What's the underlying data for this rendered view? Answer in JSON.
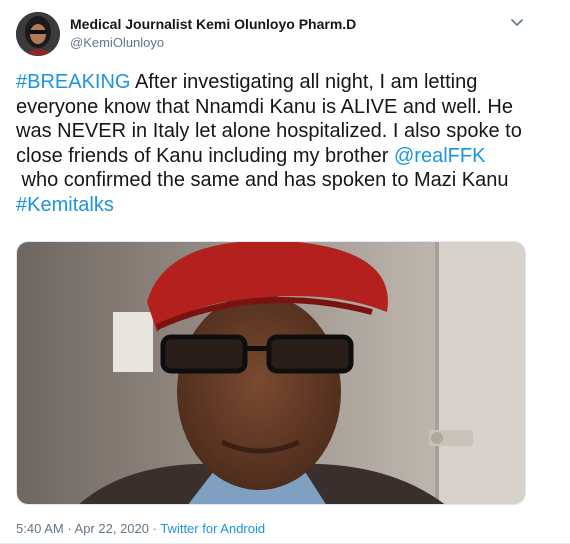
{
  "author": {
    "display_name": "Medical Journalist Kemi Olunloyo Pharm.D",
    "handle": "@KemiOlunloyo",
    "avatar_icon": "profile-photo"
  },
  "menu": {
    "icon": "chevron-down-icon"
  },
  "tweet": {
    "line1_hashtag": "#BREAKING",
    "line1_text": " After investigating all night, I am letting",
    "line2": "everyone know that Nnamdi Kanu is ALIVE and well. He",
    "line3": "was NEVER in Italy let alone hospitalized. I also spoke to",
    "line4_text": "close friends of Kanu including my brother ",
    "line4_mention": "@realFFK",
    "line5": " who confirmed the same and has spoken to Mazi Kanu",
    "line6_hashtag": "#Kemitalks"
  },
  "media": {
    "description_icon": "photo-man-red-beret-glasses"
  },
  "meta": {
    "time": "5:40 AM",
    "separator1": " · ",
    "date": "Apr 22, 2020",
    "separator2": " · ",
    "source": "Twitter for Android"
  },
  "colors": {
    "link": "#1b95e0",
    "secondary_text": "#657786",
    "primary_text": "#14171a"
  }
}
